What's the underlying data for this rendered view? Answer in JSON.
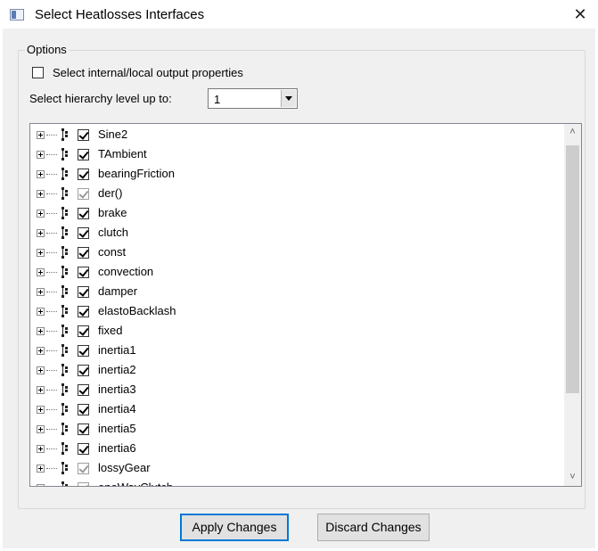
{
  "window": {
    "title": "Select Heatlosses Interfaces",
    "close_glyph": "✕"
  },
  "options": {
    "group_label": "Options",
    "internal_checkbox": {
      "label": "Select internal/local output properties",
      "checked": false
    },
    "hierarchy": {
      "label": "Select hierarchy level up to:",
      "value": "1"
    }
  },
  "tree": {
    "items": [
      {
        "label": "Sine2",
        "checked": true,
        "enabled": true
      },
      {
        "label": "TAmbient",
        "checked": true,
        "enabled": true
      },
      {
        "label": "bearingFriction",
        "checked": true,
        "enabled": true
      },
      {
        "label": "der()",
        "checked": true,
        "enabled": false
      },
      {
        "label": "brake",
        "checked": true,
        "enabled": true
      },
      {
        "label": "clutch",
        "checked": true,
        "enabled": true
      },
      {
        "label": "const",
        "checked": true,
        "enabled": true
      },
      {
        "label": "convection",
        "checked": true,
        "enabled": true
      },
      {
        "label": "damper",
        "checked": true,
        "enabled": true
      },
      {
        "label": "elastoBacklash",
        "checked": true,
        "enabled": true
      },
      {
        "label": "fixed",
        "checked": true,
        "enabled": true
      },
      {
        "label": "inertia1",
        "checked": true,
        "enabled": true
      },
      {
        "label": "inertia2",
        "checked": true,
        "enabled": true
      },
      {
        "label": "inertia3",
        "checked": true,
        "enabled": true
      },
      {
        "label": "inertia4",
        "checked": true,
        "enabled": true
      },
      {
        "label": "inertia5",
        "checked": true,
        "enabled": true
      },
      {
        "label": "inertia6",
        "checked": true,
        "enabled": true
      },
      {
        "label": "lossyGear",
        "checked": true,
        "enabled": false
      },
      {
        "label": "oneWayClutch",
        "checked": true,
        "enabled": false
      }
    ],
    "icons": {
      "expander": "expand-plus-icon",
      "node": "structure-icon"
    }
  },
  "scrollbar": {
    "up_glyph": "˄",
    "down_glyph": "˅"
  },
  "buttons": {
    "apply": "Apply Changes",
    "discard": "Discard Changes"
  },
  "colors": {
    "accent": "#0078d7",
    "dialog_bg": "#f0f0f0",
    "tree_bg": "#ffffff"
  }
}
